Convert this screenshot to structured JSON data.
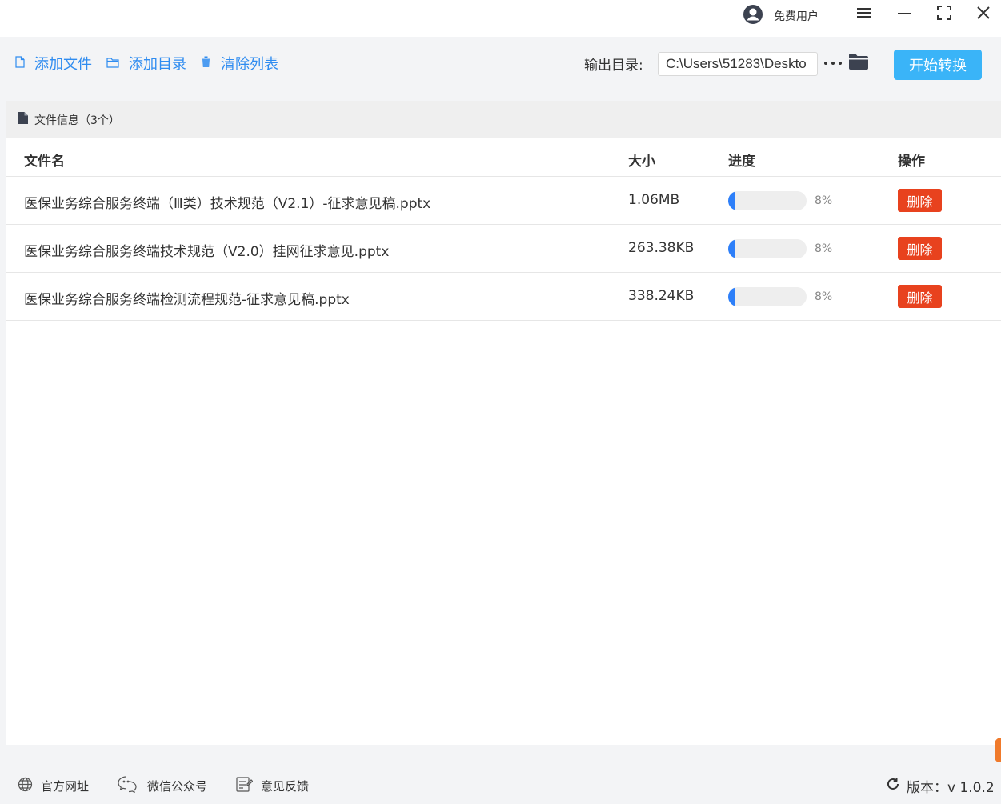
{
  "titlebar": {
    "user_name": "免费用户"
  },
  "toolbar": {
    "add_file": "添加文件",
    "add_folder": "添加目录",
    "clear_list": "清除列表",
    "output_label": "输出目录:",
    "output_path": "C:\\Users\\51283\\Deskto",
    "start_button": "开始转换"
  },
  "panel": {
    "title": "文件信息（3个）",
    "columns": {
      "name": "文件名",
      "size": "大小",
      "progress": "进度",
      "action": "操作"
    },
    "rows": [
      {
        "name": "医保业务综合服务终端（Ⅲ类）技术规范（V2.1）-征求意见稿.pptx",
        "size": "1.06MB",
        "progress_text": "8%",
        "progress": 0.08,
        "delete": "删除"
      },
      {
        "name": "医保业务综合服务终端技术规范（V2.0）挂网征求意见.pptx",
        "size": "263.38KB",
        "progress_text": "8%",
        "progress": 0.08,
        "delete": "删除"
      },
      {
        "name": "医保业务综合服务终端检测流程规范-征求意见稿.pptx",
        "size": "338.24KB",
        "progress_text": "8%",
        "progress": 0.08,
        "delete": "删除"
      }
    ]
  },
  "footer": {
    "website": "官方网址",
    "wechat": "微信公众号",
    "feedback": "意见反馈",
    "version": "版本：v 1.0.2"
  },
  "colors": {
    "accent": "#2f8cf0",
    "start_button": "#3ab4f8",
    "delete_button": "#e8421e",
    "progress_fill": "#2d7ff9"
  },
  "icons": [
    "user-avatar-icon",
    "menu-icon",
    "minimize-icon",
    "maximize-icon",
    "close-icon",
    "file-icon",
    "folder-icon",
    "trash-icon",
    "more-icon",
    "folder-browse-icon",
    "document-icon",
    "globe-icon",
    "chat-icon",
    "edit-icon",
    "refresh-icon"
  ]
}
